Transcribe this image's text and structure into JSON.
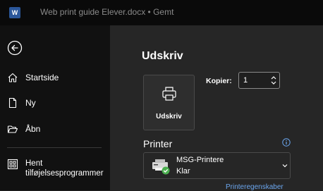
{
  "titlebar": {
    "app_icon": "word-logo",
    "app_letter": "W",
    "document_title": "Web print guide Elever.docx • Gemt"
  },
  "sidebar": {
    "back_icon": "back-arrow-icon",
    "items": [
      {
        "label": "Startside",
        "icon": "home-icon"
      },
      {
        "label": "Ny",
        "icon": "new-document-icon"
      },
      {
        "label": "Åbn",
        "icon": "open-folder-icon"
      },
      {
        "label_line1": "Hent",
        "label_line2": "tilføjelsesprogrammer",
        "icon": "addins-icon"
      }
    ]
  },
  "main": {
    "heading": "Udskriv",
    "print_button": {
      "label": "Udskriv",
      "icon": "printer-icon"
    },
    "copies": {
      "label": "Kopier:",
      "value": "1"
    },
    "printer_section": {
      "title": "Printer",
      "info_icon": "info-icon",
      "selected_printer": {
        "name": "MSG-Printere",
        "status": "Klar",
        "status_color": "#4caf50"
      },
      "properties_link": "Printeregenskaber"
    }
  },
  "colors": {
    "accent": "#6ba6ee",
    "word_brand": "#2b579a",
    "sidebar_bg": "#111111",
    "main_bg": "#262626"
  }
}
